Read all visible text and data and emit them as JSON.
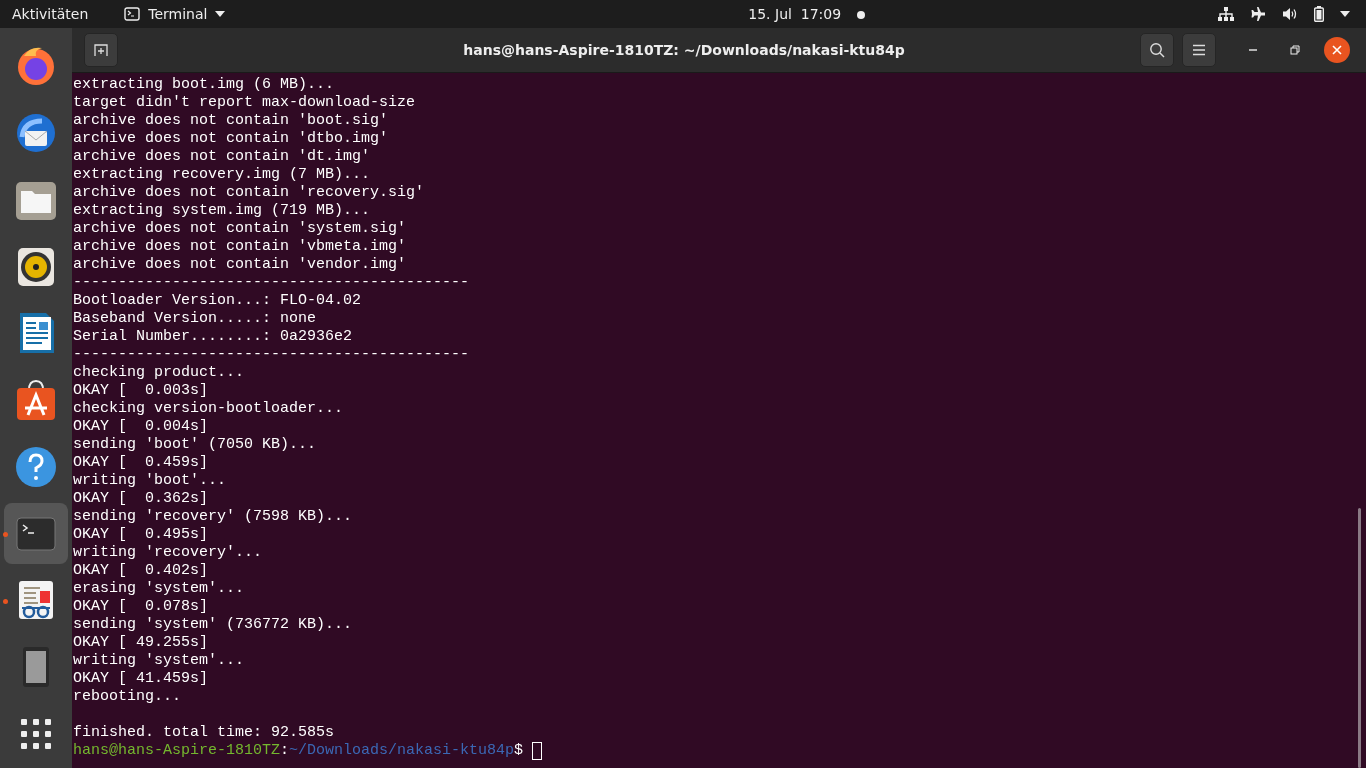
{
  "top_bar": {
    "activities": "Aktivitäten",
    "app_menu": "Terminal",
    "clock": "15. Jul  17:09",
    "notification": true
  },
  "dock": [
    {
      "running": false,
      "selected": false
    },
    {
      "running": false,
      "selected": false
    },
    {
      "running": false,
      "selected": false
    },
    {
      "running": false,
      "selected": false
    },
    {
      "running": false,
      "selected": false
    },
    {
      "running": false,
      "selected": false
    },
    {
      "running": false,
      "selected": false
    },
    {
      "running": true,
      "selected": true
    },
    {
      "running": true,
      "selected": false
    },
    {
      "running": false,
      "selected": false
    },
    {
      "running": false,
      "selected": false
    }
  ],
  "window": {
    "title": "hans@hans-Aspire-1810TZ: ~/Downloads/nakasi-ktu84p"
  },
  "terminal": {
    "output": [
      "extracting boot.img (6 MB)...",
      "target didn't report max-download-size",
      "archive does not contain 'boot.sig'",
      "archive does not contain 'dtbo.img'",
      "archive does not contain 'dt.img'",
      "extracting recovery.img (7 MB)...",
      "archive does not contain 'recovery.sig'",
      "extracting system.img (719 MB)...",
      "archive does not contain 'system.sig'",
      "archive does not contain 'vbmeta.img'",
      "archive does not contain 'vendor.img'",
      "--------------------------------------------",
      "Bootloader Version...: FLO-04.02",
      "Baseband Version.....: none",
      "Serial Number........: 0a2936e2",
      "--------------------------------------------",
      "checking product...",
      "OKAY [  0.003s]",
      "checking version-bootloader...",
      "OKAY [  0.004s]",
      "sending 'boot' (7050 KB)...",
      "OKAY [  0.459s]",
      "writing 'boot'...",
      "OKAY [  0.362s]",
      "sending 'recovery' (7598 KB)...",
      "OKAY [  0.495s]",
      "writing 'recovery'...",
      "OKAY [  0.402s]",
      "erasing 'system'...",
      "OKAY [  0.078s]",
      "sending 'system' (736772 KB)...",
      "OKAY [ 49.255s]",
      "writing 'system'...",
      "OKAY [ 41.459s]",
      "rebooting..."
    ],
    "summary": "finished. total time: 92.585s",
    "prompt": {
      "user_host": "hans@hans-Aspire-1810TZ",
      "separator": ":",
      "path": "~/Downloads/nakasi-ktu84p",
      "symbol": "$"
    }
  }
}
